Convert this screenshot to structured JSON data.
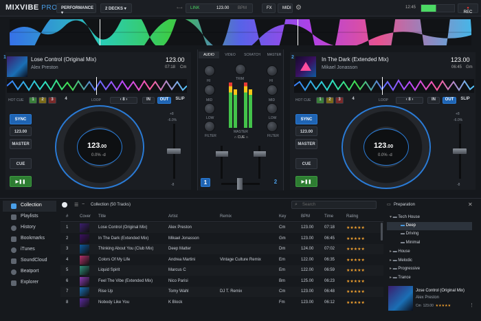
{
  "app": {
    "logo": "MIXVIBE",
    "logo_suffix": "PRO",
    "mode": "PERFORMANCE",
    "decks": "2 DECKS",
    "link": "LINK",
    "bpm": "123.00",
    "bpm_unit": "BPM",
    "fx": "FX",
    "midi": "MIDI",
    "time": "12:45",
    "rec": "REC"
  },
  "deck1": {
    "number": "1",
    "title": "Lose Control (Original Mix)",
    "artist": "Alex Preston",
    "bpm": "123.00",
    "time": "07:18",
    "key": "Cm",
    "hotcue_label": "HOT CUE",
    "hotcues": [
      "1",
      "2",
      "3",
      "4"
    ],
    "loop_label": "LOOP",
    "loop_size": "8",
    "in": "IN",
    "out": "OUT",
    "slip": "SLIP",
    "sync": "SYNC",
    "sync_bpm": "123.00",
    "master": "MASTER",
    "cue": "CUE",
    "jog_bpm_main": "123",
    "jog_bpm_dec": ".00",
    "jog_pitch": "0.0%",
    "jog_pitch_suffix": "-d",
    "pitch_top": "+8",
    "pitch_mid": "-6.0%",
    "pitch_bottom": "-8"
  },
  "deck2": {
    "number": "2",
    "title": "In The Dark (Extended Mix)",
    "artist": "Mikael Jonasson",
    "bpm": "123.00",
    "time": "06:45",
    "key": "Gm",
    "hotcue_label": "HOT CUE",
    "hotcues": [
      "1",
      "2",
      "3",
      "4"
    ],
    "loop_label": "LOOP",
    "loop_size": "8",
    "in": "IN",
    "out": "OUT",
    "slip": "SLIP",
    "sync": "SYNC",
    "sync_bpm": "123.00",
    "master": "MASTER",
    "cue": "CUE",
    "jog_bpm_main": "123",
    "jog_bpm_dec": ".00",
    "jog_pitch": "0.0%",
    "jog_pitch_suffix": "-d",
    "pitch_top": "+8",
    "pitch_mid": "-6.0%",
    "pitch_bottom": "-8"
  },
  "mixer": {
    "tabs": [
      "AUDIO",
      "VIDEO",
      "SCRATCH",
      "MASTER"
    ],
    "trim": "TRIM",
    "hi": "HI",
    "mid": "MID",
    "low": "LOW",
    "filter": "FILTER",
    "master": "MASTER",
    "cue": "CUE",
    "ch1": "1",
    "ch2": "2"
  },
  "sidebar": {
    "items": [
      {
        "label": "Collection",
        "icon": "collection-icon"
      },
      {
        "label": "Playlists",
        "icon": "playlist-icon"
      },
      {
        "label": "History",
        "icon": "history-icon"
      },
      {
        "label": "Bookmarks",
        "icon": "bookmark-icon"
      },
      {
        "label": "iTunes",
        "icon": "itunes-icon"
      },
      {
        "label": "SoundCloud",
        "icon": "soundcloud-icon"
      },
      {
        "label": "Beatport",
        "icon": "beatport-icon"
      },
      {
        "label": "Explorer",
        "icon": "explorer-icon"
      }
    ]
  },
  "library": {
    "header": "Collection (50 Tracks)",
    "search_placeholder": "Search",
    "columns": [
      "#",
      "Cover",
      "Title",
      "Artist",
      "Remix",
      "Key",
      "BPM",
      "Time",
      "Rating"
    ],
    "rows": [
      {
        "n": "1",
        "title": "Lose Control (Original Mix)",
        "artist": "Alex Preston",
        "remix": "",
        "key": "Cm",
        "bpm": "123.00",
        "time": "07:18",
        "rating": "★★★★★"
      },
      {
        "n": "2",
        "title": "In The Dark (Extended Mix)",
        "artist": "Mikael Jonasson",
        "remix": "",
        "key": "Gm",
        "bpm": "123.00",
        "time": "06:45",
        "rating": "★★★★★"
      },
      {
        "n": "3",
        "title": "Thinking About You (Club Mix)",
        "artist": "Deep Matter",
        "remix": "",
        "key": "Dm",
        "bpm": "124.00",
        "time": "07:02",
        "rating": "★★★★★"
      },
      {
        "n": "4",
        "title": "Colors Of My Life",
        "artist": "Andrea Martini",
        "remix": "Vintage Culture Remix",
        "key": "Em",
        "bpm": "122.00",
        "time": "06:35",
        "rating": "★★★★★"
      },
      {
        "n": "5",
        "title": "Liquid Spirit",
        "artist": "Marcus C",
        "remix": "",
        "key": "Em",
        "bpm": "122.00",
        "time": "06:59",
        "rating": "★★★★★"
      },
      {
        "n": "6",
        "title": "Feel The Vibe (Extended Mix)",
        "artist": "Nico Parisi",
        "remix": "",
        "key": "Bm",
        "bpm": "125.00",
        "time": "06:23",
        "rating": "★★★★★"
      },
      {
        "n": "7",
        "title": "Rise Up",
        "artist": "Tomy Wahl",
        "remix": "DJ T. Remix",
        "key": "Cm",
        "bpm": "123.00",
        "time": "06:48",
        "rating": "★★★★★"
      },
      {
        "n": "8",
        "title": "Nobody Like You",
        "artist": "K Block",
        "remix": "",
        "key": "Fm",
        "bpm": "123.00",
        "time": "06:12",
        "rating": "★★★★★"
      }
    ]
  },
  "prep": {
    "title": "Preparation",
    "tree": [
      {
        "label": "Tech House",
        "level": 0
      },
      {
        "label": "Deep",
        "level": 1,
        "selected": true
      },
      {
        "label": "Driving",
        "level": 1
      },
      {
        "label": "Minimal",
        "level": 1
      },
      {
        "label": "House",
        "level": 0
      },
      {
        "label": "Melodic",
        "level": 0
      },
      {
        "label": "Progressive",
        "level": 0
      },
      {
        "label": "Trance",
        "level": 0
      }
    ],
    "now_title": "Jose Control (Original Mix)",
    "now_artist": "Alex Preston",
    "now_key": "Cm",
    "now_bpm": "123.00",
    "now_rating": "★★★★★"
  },
  "colors": {
    "accent": "#2a7bd6",
    "green": "#3d9c41",
    "rec": "#e53935"
  }
}
